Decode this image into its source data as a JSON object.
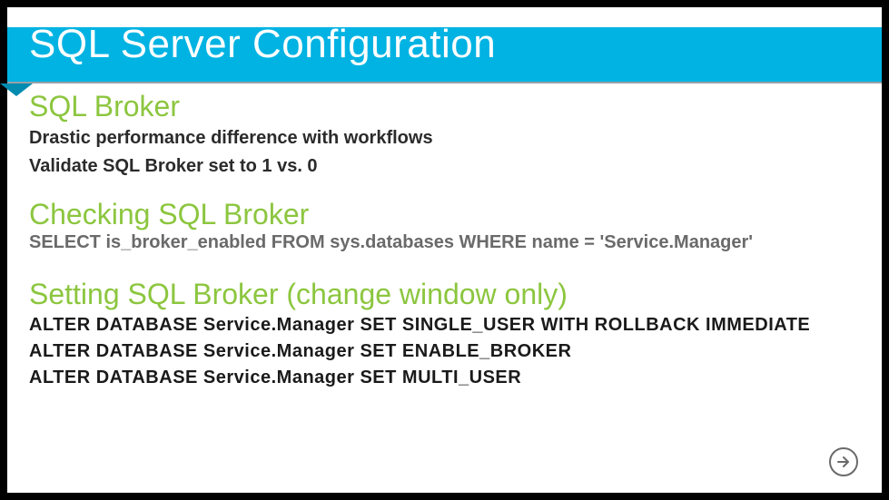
{
  "title": "SQL Server Configuration",
  "sections": {
    "s1": {
      "heading": "SQL Broker",
      "line1": "Drastic performance difference with workflows",
      "line2": "Validate SQL Broker set to 1 vs. 0"
    },
    "s2": {
      "heading": "Checking SQL Broker",
      "sql": "SELECT is_broker_enabled FROM sys.databases WHERE name = 'Service.Manager'"
    },
    "s3": {
      "heading": "Setting SQL Broker (change window only)",
      "code1": "ALTER DATABASE Service.Manager SET SINGLE_USER WITH ROLLBACK IMMEDIATE",
      "code2": "ALTER DATABASE Service.Manager SET ENABLE_BROKER",
      "code3": "ALTER DATABASE Service.Manager SET MULTI_USER"
    }
  },
  "colors": {
    "accent": "#00b3e3",
    "green": "#8cc63f"
  },
  "nav": {
    "nextLabel": "next"
  }
}
